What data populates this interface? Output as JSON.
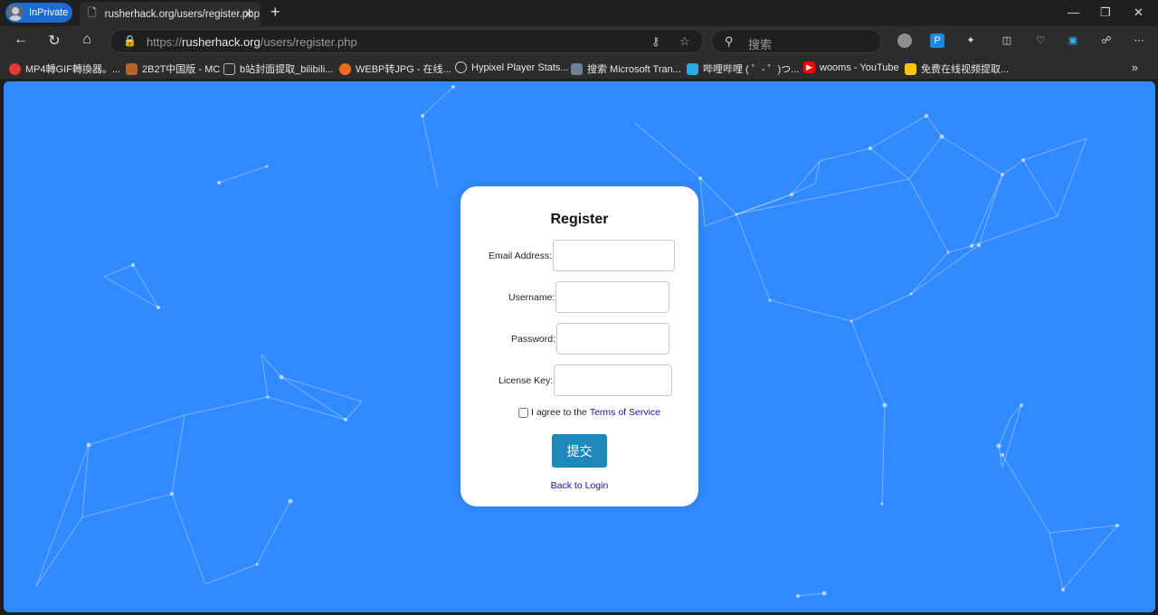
{
  "browser": {
    "profile_label": "InPrivate",
    "tab_title": "rusherhack.org/users/register.php",
    "url_prefix": "https://",
    "url_domain": "rusherhack.org",
    "url_path": "/users/register.php",
    "search_placeholder": "搜索",
    "more_bookmarks": "»"
  },
  "bookmarks": [
    {
      "label": "MP4轉GIF轉換器。...",
      "icon_color": "#e53935"
    },
    {
      "label": "2B2T中国版 - MC",
      "icon_color": "#b5652a"
    },
    {
      "label": "b站封面提取_bilibili...",
      "icon_color": "#8a8a8a"
    },
    {
      "label": "WEBP转JPG - 在线...",
      "icon_color": "#ef6c1a"
    },
    {
      "label": "Hypixel Player Stats...",
      "icon_color": "#9e9e9e"
    },
    {
      "label": "搜索 Microsoft Tran...",
      "icon_color": "#6f7f96"
    },
    {
      "label": "哔哩哔哩 ( ゜- ゜)つ...",
      "icon_color": "#23ade5"
    },
    {
      "label": "wooms - YouTube",
      "icon_color": "#ff0000"
    },
    {
      "label": "免费在线视频提取...",
      "icon_color": "#f5c518"
    }
  ],
  "form": {
    "title": "Register",
    "email_label": "Email Address:",
    "username_label": "Username:",
    "password_label": "Password:",
    "license_label": "License Key:",
    "agree_text": "I agree to the",
    "terms_link": "Terms of Service",
    "submit_label": "提交",
    "back_link": "Back to Login"
  },
  "colors": {
    "page_background": "#318aff",
    "submit_button": "#1e88b8",
    "link": "#1a0dab"
  }
}
